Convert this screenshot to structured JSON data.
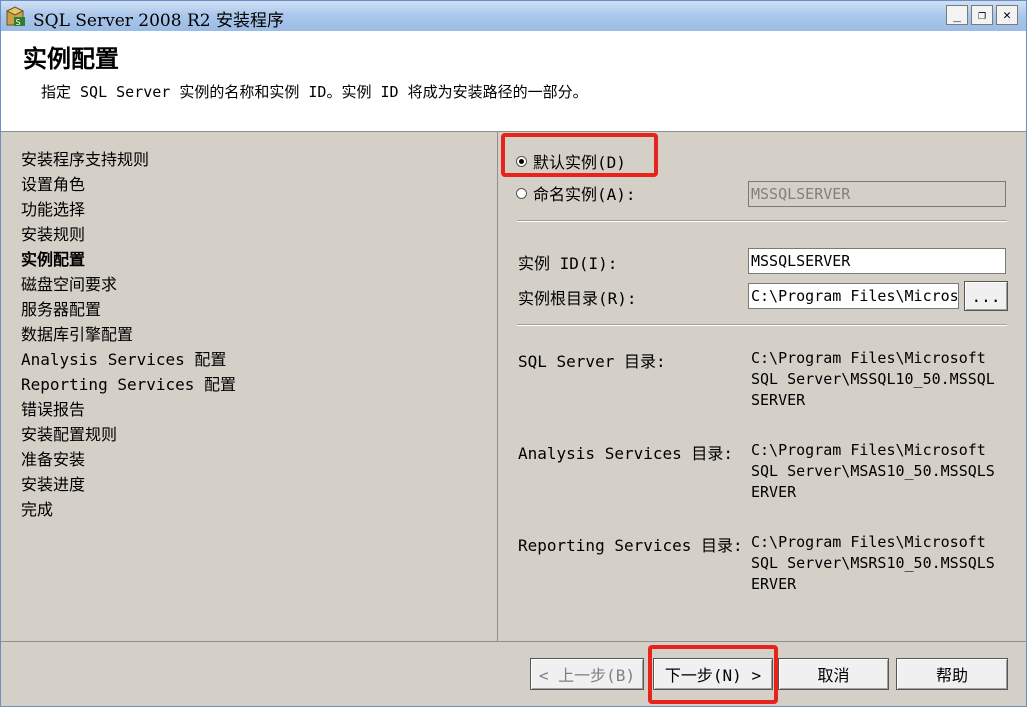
{
  "window": {
    "title": "SQL Server 2008 R2 安装程序",
    "controls": {
      "minimize": "_",
      "restore": "❐",
      "close": "✕"
    }
  },
  "header": {
    "title": "实例配置",
    "description": "指定 SQL Server 实例的名称和实例 ID。实例 ID 将成为安装路径的一部分。"
  },
  "nav": {
    "items": [
      {
        "label": "安装程序支持规则",
        "active": false
      },
      {
        "label": "设置角色",
        "active": false
      },
      {
        "label": "功能选择",
        "active": false
      },
      {
        "label": "安装规则",
        "active": false
      },
      {
        "label": "实例配置",
        "active": true
      },
      {
        "label": "磁盘空间要求",
        "active": false
      },
      {
        "label": "服务器配置",
        "active": false
      },
      {
        "label": "数据库引擎配置",
        "active": false
      },
      {
        "label": "Analysis Services 配置",
        "active": false
      },
      {
        "label": "Reporting Services 配置",
        "active": false
      },
      {
        "label": "错误报告",
        "active": false
      },
      {
        "label": "安装配置规则",
        "active": false
      },
      {
        "label": "准备安装",
        "active": false
      },
      {
        "label": "安装进度",
        "active": false
      },
      {
        "label": "完成",
        "active": false
      }
    ]
  },
  "instance": {
    "default_label": "默认实例(D)",
    "named_label": "命名实例(A):",
    "selected": "default",
    "named_value": "MSSQLSERVER",
    "id_label": "实例 ID(I):",
    "id_value": "MSSQLSERVER",
    "root_label": "实例根目录(R):",
    "root_value": "C:\\Program Files\\Microsoft SQL Server\\",
    "browse_label": "..."
  },
  "directories": [
    {
      "label": "SQL Server 目录:",
      "value": "C:\\Program Files\\Microsoft SQL Server\\MSSQL10_50.MSSQLSERVER"
    },
    {
      "label": "Analysis Services 目录:",
      "value": "C:\\Program Files\\Microsoft SQL Server\\MSAS10_50.MSSQLSERVER"
    },
    {
      "label": "Reporting Services 目录:",
      "value": "C:\\Program Files\\Microsoft SQL Server\\MSRS10_50.MSSQLSERVER"
    }
  ],
  "buttons": {
    "back": "< 上一步(B)",
    "next": "下一步(N) >",
    "cancel": "取消",
    "help": "帮助"
  },
  "colors": {
    "highlight": "#e8231b",
    "titlebar": "#a9c6ea",
    "dialog_bg": "#d4d0c8"
  }
}
